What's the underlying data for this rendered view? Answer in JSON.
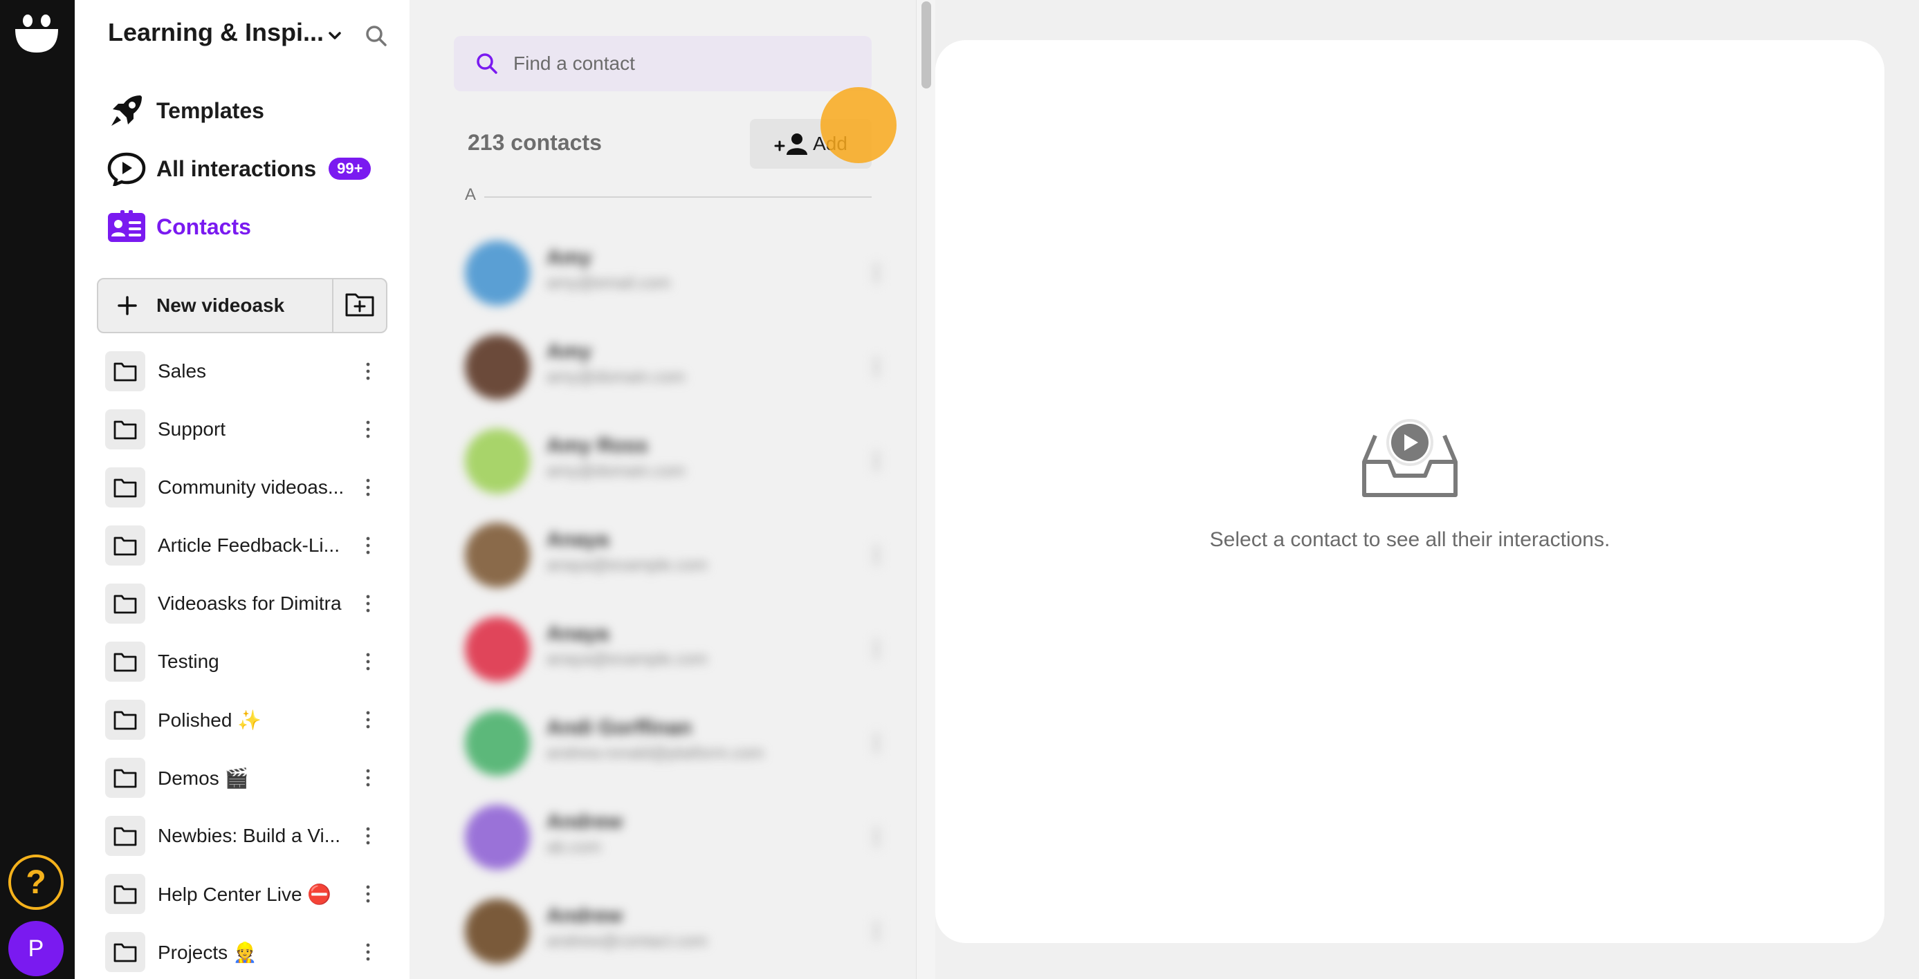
{
  "workspace": {
    "title": "Learning & Inspi..."
  },
  "nav": [
    {
      "label": "Templates"
    },
    {
      "label": "All interactions",
      "badge": "99+"
    },
    {
      "label": "Contacts"
    }
  ],
  "new_videoask": {
    "label": "New videoask"
  },
  "folders": [
    {
      "label": "Sales"
    },
    {
      "label": "Support"
    },
    {
      "label": "Community videoas..."
    },
    {
      "label": "Article Feedback-Li..."
    },
    {
      "label": "Videoasks for Dimitra"
    },
    {
      "label": "Testing"
    },
    {
      "label": "Polished ✨"
    },
    {
      "label": "Demos 🎬"
    },
    {
      "label": "Newbies: Build a Vi..."
    },
    {
      "label": "Help Center Live ⛔"
    },
    {
      "label": "Projects 👷"
    }
  ],
  "contacts": {
    "search_placeholder": "Find a contact",
    "count_label": "213 contacts",
    "add_label": "Add",
    "section_letter": "A",
    "rows": [
      {
        "name": "Amy",
        "email": "amy@email.com",
        "avatar_color": "#5a9fd4"
      },
      {
        "name": "Amy",
        "email": "amy@domain.com",
        "avatar_color": "#6b4a3a"
      },
      {
        "name": "Amy Ross",
        "email": "amy@domain.com",
        "avatar_color": "#a8d46a"
      },
      {
        "name": "Anaya",
        "email": "anaya@example.com",
        "avatar_color": "#8a6a4a"
      },
      {
        "name": "Anaya",
        "email": "anaya@example.com",
        "avatar_color": "#e0455a"
      },
      {
        "name": "Andi Gorffinan",
        "email": "andrew.ronald@platform.com",
        "avatar_color": "#5cb87a"
      },
      {
        "name": "Andrew",
        "email": "ab.com",
        "avatar_color": "#9a72d8"
      },
      {
        "name": "Andrew",
        "email": "andrew@contact.com",
        "avatar_color": "#7a5a3a"
      }
    ]
  },
  "rail": {
    "help_label": "?",
    "avatar_initial": "P"
  },
  "detail": {
    "empty_message": "Select a contact to see all their interactions."
  },
  "colors": {
    "accent": "#7a1af0",
    "help": "#f5b21c",
    "click_indicator": "#f9a91c"
  }
}
